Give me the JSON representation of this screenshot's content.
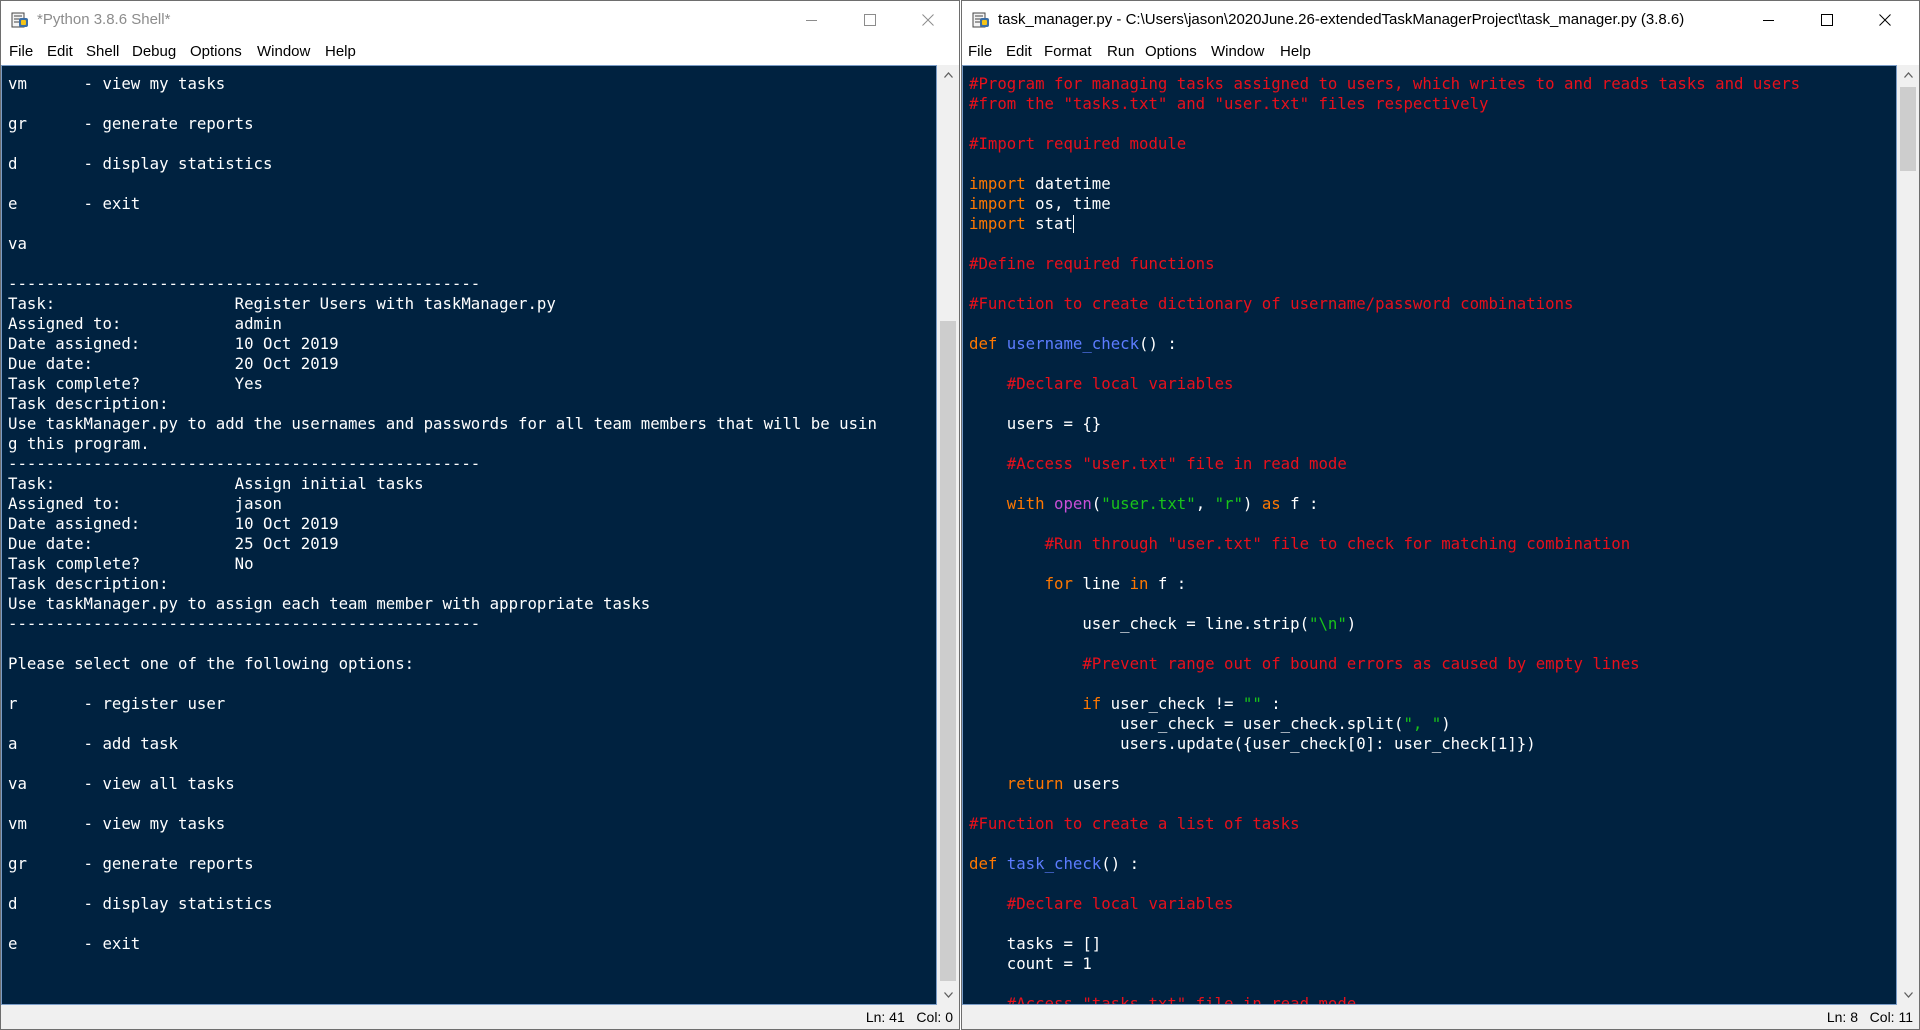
{
  "colors": {
    "code_bg": "#002240",
    "code_text": "#ffffff",
    "comment": "#e8101b",
    "keyword": "#ff7700",
    "def_name": "#5c7cff",
    "builtin": "#c94fd6",
    "string": "#19c419"
  },
  "shell": {
    "title": "*Python 3.8.6 Shell*",
    "menu": [
      "File",
      "Edit",
      "Shell",
      "Debug",
      "Options",
      "Window",
      "Help"
    ],
    "status": "Ln: 41   Col: 0",
    "lines": [
      "vm      - view my tasks",
      "",
      "gr      - generate reports",
      "",
      "d       - display statistics",
      "",
      "e       - exit",
      "",
      "va",
      "",
      "--------------------------------------------------",
      "Task:                   Register Users with taskManager.py",
      "Assigned to:            admin",
      "Date assigned:          10 Oct 2019",
      "Due date:               20 Oct 2019",
      "Task complete?          Yes",
      "Task description:",
      "Use taskManager.py to add the usernames and passwords for all team members that will be usin",
      "g this program.",
      "--------------------------------------------------",
      "Task:                   Assign initial tasks",
      "Assigned to:            jason",
      "Date assigned:          10 Oct 2019",
      "Due date:               25 Oct 2019",
      "Task complete?          No",
      "Task description:",
      "Use taskManager.py to assign each team member with appropriate tasks",
      "--------------------------------------------------",
      "",
      "Please select one of the following options:",
      "",
      "r       - register user",
      "",
      "a       - add task",
      "",
      "va      - view all tasks",
      "",
      "vm      - view my tasks",
      "",
      "gr      - generate reports",
      "",
      "d       - display statistics",
      "",
      "e       - exit"
    ]
  },
  "editor": {
    "title": "task_manager.py - C:\\Users\\jason\\2020June.26-extendedTaskManagerProject\\task_manager.py (3.8.6)",
    "menu": [
      "File",
      "Edit",
      "Format",
      "Run",
      "Options",
      "Window",
      "Help"
    ],
    "status": "Ln: 8   Col: 11",
    "lines": [
      [
        {
          "t": "#Program for managing tasks assigned to users, which writes to and reads tasks and users",
          "c": "comment"
        }
      ],
      [
        {
          "t": "#from the \"tasks.txt\" and \"user.txt\" files respectively",
          "c": "comment"
        }
      ],
      [],
      [
        {
          "t": "#Import required module",
          "c": "comment"
        }
      ],
      [],
      [
        {
          "t": "import",
          "c": "keyword"
        },
        {
          "t": " datetime"
        }
      ],
      [
        {
          "t": "import",
          "c": "keyword"
        },
        {
          "t": " os, time"
        }
      ],
      [
        {
          "t": "import",
          "c": "keyword"
        },
        {
          "t": " stat"
        },
        {
          "cursor": true
        }
      ],
      [],
      [
        {
          "t": "#Define required functions",
          "c": "comment"
        }
      ],
      [],
      [
        {
          "t": "#Function to create dictionary of username/password combinations",
          "c": "comment"
        }
      ],
      [],
      [
        {
          "t": "def",
          "c": "keyword"
        },
        {
          "t": " "
        },
        {
          "t": "username_check",
          "c": "def_name"
        },
        {
          "t": "() :"
        }
      ],
      [],
      [
        {
          "t": "    "
        },
        {
          "t": "#Declare local variables",
          "c": "comment"
        }
      ],
      [],
      [
        {
          "t": "    users = {}"
        }
      ],
      [],
      [
        {
          "t": "    "
        },
        {
          "t": "#Access \"user.txt\" file in read mode",
          "c": "comment"
        }
      ],
      [],
      [
        {
          "t": "    "
        },
        {
          "t": "with",
          "c": "keyword"
        },
        {
          "t": " "
        },
        {
          "t": "open",
          "c": "builtin"
        },
        {
          "t": "("
        },
        {
          "t": "\"user.txt\"",
          "c": "string"
        },
        {
          "t": ", "
        },
        {
          "t": "\"r\"",
          "c": "string"
        },
        {
          "t": ") "
        },
        {
          "t": "as",
          "c": "keyword"
        },
        {
          "t": " f :"
        }
      ],
      [],
      [
        {
          "t": "        "
        },
        {
          "t": "#Run through \"user.txt\" file to check for matching combination",
          "c": "comment"
        }
      ],
      [],
      [
        {
          "t": "        "
        },
        {
          "t": "for",
          "c": "keyword"
        },
        {
          "t": " line "
        },
        {
          "t": "in",
          "c": "keyword"
        },
        {
          "t": " f :"
        }
      ],
      [],
      [
        {
          "t": "            user_check = line.strip("
        },
        {
          "t": "\"\\n\"",
          "c": "string"
        },
        {
          "t": ")"
        }
      ],
      [],
      [
        {
          "t": "            "
        },
        {
          "t": "#Prevent range out of bound errors as caused by empty lines",
          "c": "comment"
        }
      ],
      [],
      [
        {
          "t": "            "
        },
        {
          "t": "if",
          "c": "keyword"
        },
        {
          "t": " user_check != "
        },
        {
          "t": "\"\"",
          "c": "string"
        },
        {
          "t": " :"
        }
      ],
      [
        {
          "t": "                user_check = user_check.split("
        },
        {
          "t": "\", \"",
          "c": "string"
        },
        {
          "t": ")"
        }
      ],
      [
        {
          "t": "                users.update({user_check[0]: user_check[1]})"
        }
      ],
      [],
      [
        {
          "t": "    "
        },
        {
          "t": "return",
          "c": "keyword"
        },
        {
          "t": " users"
        }
      ],
      [],
      [
        {
          "t": "#Function to create a list of tasks",
          "c": "comment"
        }
      ],
      [],
      [
        {
          "t": "def",
          "c": "keyword"
        },
        {
          "t": " "
        },
        {
          "t": "task_check",
          "c": "def_name"
        },
        {
          "t": "() :"
        }
      ],
      [],
      [
        {
          "t": "    "
        },
        {
          "t": "#Declare local variables",
          "c": "comment"
        }
      ],
      [],
      [
        {
          "t": "    tasks = []"
        }
      ],
      [
        {
          "t": "    count = 1"
        }
      ],
      [],
      [
        {
          "t": "    "
        },
        {
          "t": "#Access \"tasks.txt\" file in read mode",
          "c": "comment"
        }
      ]
    ]
  }
}
